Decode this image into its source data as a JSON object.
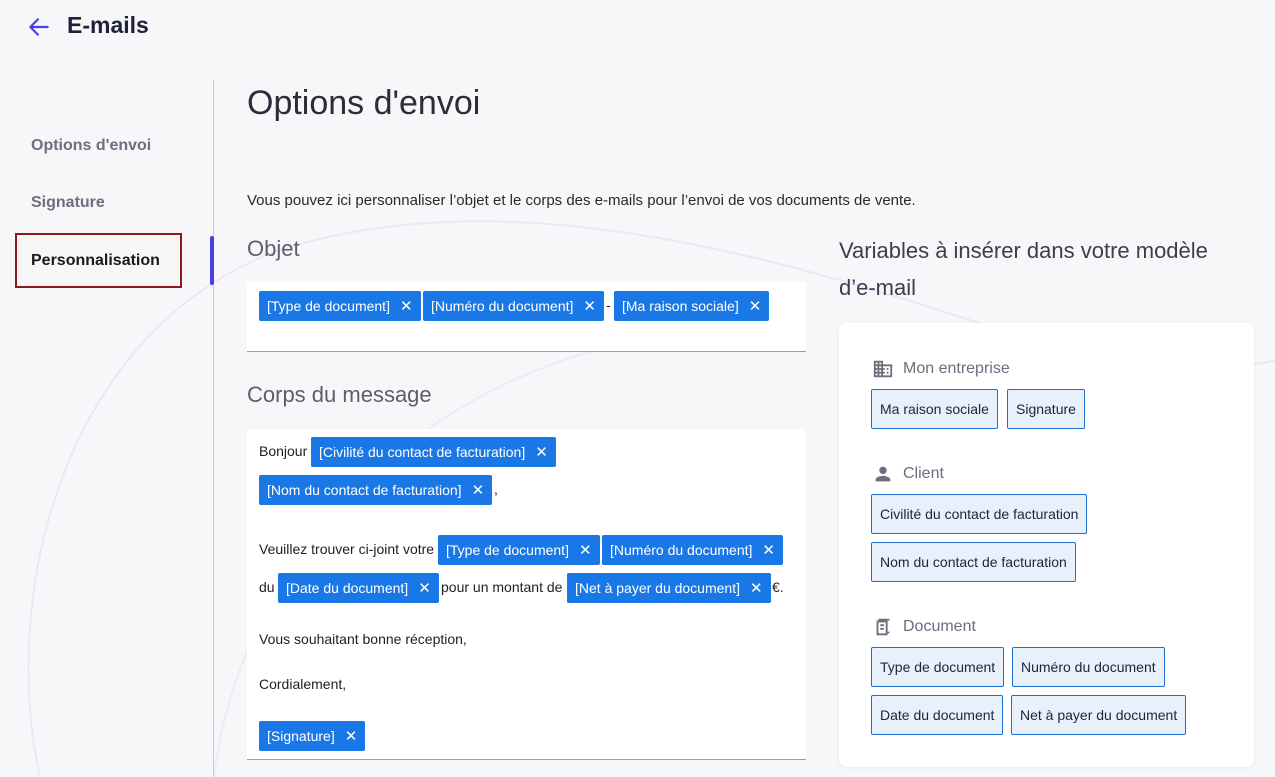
{
  "header": {
    "title": "E-mails"
  },
  "sidebar": {
    "items": [
      {
        "label": "Options d'envoi"
      },
      {
        "label": "Signature"
      },
      {
        "label": "Personnalisation"
      }
    ]
  },
  "main": {
    "title": "Options d'envoi",
    "intro": "Vous pouvez ici personnaliser l’objet et le corps des e-mails pour l’envoi de vos documents de vente.",
    "subject": {
      "heading": "Objet",
      "chips": [
        "[Type de document]",
        "[Numéro du document]",
        "[Ma raison sociale]"
      ],
      "separator": "-"
    },
    "body": {
      "heading": "Corps du message",
      "greeting": "Bonjour",
      "chips": [
        "[Civilité du contact de facturation]",
        "[Nom du contact de facturation]",
        "[Type de document]",
        "[Numéro du document]",
        "[Date du document]",
        "[Net à payer du document]",
        "[Signature]"
      ],
      "comma": ",",
      "line2_prefix": "Veuillez trouver ci-joint votre",
      "line3_prefix": "du",
      "line3_mid": "pour un montant de",
      "line3_suffix": "€.",
      "closing1": "Vous souhaitant bonne réception,",
      "closing2": "Cordialement,"
    },
    "close_symbol": "✕"
  },
  "variables": {
    "title": "Variables à insérer dans votre modèle d’e-mail",
    "groups": [
      {
        "name": "Mon entreprise",
        "icon": "building-icon",
        "items": [
          "Ma raison sociale",
          "Signature"
        ]
      },
      {
        "name": "Client",
        "icon": "person-icon",
        "items": [
          "Civilité du contact de facturation",
          "Nom du contact de facturation"
        ]
      },
      {
        "name": "Document",
        "icon": "receipt-icon",
        "items": [
          "Type de document",
          "Numéro du document",
          "Date du document",
          "Net à payer du document"
        ]
      }
    ]
  },
  "colors": {
    "accent": "#4b3fe0",
    "chip": "#1a78e6",
    "highlight": "#8b1a1a"
  }
}
